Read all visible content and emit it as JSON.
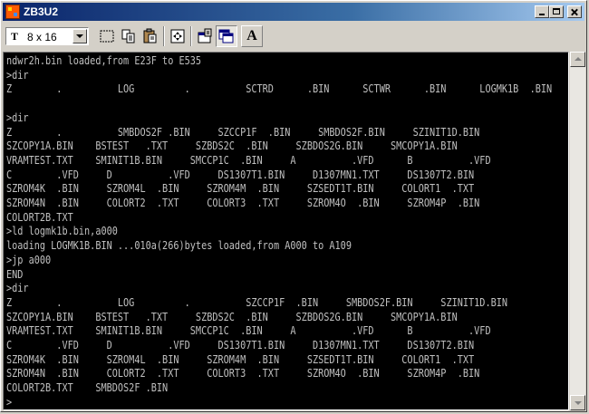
{
  "window": {
    "title": "ZB3U2"
  },
  "toolbar": {
    "font_select_value": "8 x 16",
    "font_icon_glyph": "T",
    "font_button_glyph": "A",
    "icons": [
      "font-select-icon",
      "select-icon",
      "copy-icon",
      "paste-icon",
      "fullscreen-icon",
      "properties-icon",
      "background-icon",
      "font-icon"
    ]
  },
  "console": {
    "text_color": "#c0c0c0",
    "background_color": "#000000",
    "lines": [
      "ndwr2h.bin loaded,from E23F to E535",
      ">dir",
      "Z        .          LOG         .          SCTRD      .BIN      SCTWR      .BIN      LOGMK1B  .BIN",
      "",
      ">dir",
      "Z        .          SMBDOS2F .BIN     SZCCP1F  .BIN     SMBDOS2F.BIN     SZINIT1D.BIN",
      "SZCOPY1A.BIN    BSTEST   .TXT     SZBDS2C  .BIN     SZBDOS2G.BIN     SMCOPY1A.BIN",
      "VRAMTEST.TXT    SMINIT1B.BIN     SMCCP1C  .BIN     A          .VFD      B          .VFD",
      "C        .VFD     D          .VFD     DS1307T1.BIN     D1307MN1.TXT     DS1307T2.BIN",
      "SZROM4K  .BIN     SZROM4L  .BIN     SZROM4M  .BIN     SZSEDT1T.BIN     COLORT1  .TXT",
      "SZROM4N  .BIN     COLORT2  .TXT     COLORT3  .TXT     SZROM4O  .BIN     SZROM4P  .BIN",
      "COLORT2B.TXT",
      ">ld logmk1b.bin,a000",
      "loading LOGMK1B.BIN ...010a(266)bytes loaded,from A000 to A109",
      ">jp a000",
      "END",
      ">dir",
      "Z        .          LOG         .          SZCCP1F  .BIN     SMBDOS2F.BIN     SZINIT1D.BIN",
      "SZCOPY1A.BIN    BSTEST   .TXT     SZBDS2C  .BIN     SZBDOS2G.BIN     SMCOPY1A.BIN",
      "VRAMTEST.TXT    SMINIT1B.BIN     SMCCP1C  .BIN     A          .VFD      B          .VFD",
      "C        .VFD     D          .VFD     DS1307T1.BIN     D1307MN1.TXT     DS1307T2.BIN",
      "SZROM4K  .BIN     SZROM4L  .BIN     SZROM4M  .BIN     SZSEDT1T.BIN     COLORT1  .TXT",
      "SZROM4N  .BIN     COLORT2  .TXT     COLORT3  .TXT     SZROM4O  .BIN     SZROM4P  .BIN",
      "COLORT2B.TXT    SMBDOS2F .BIN",
      ">"
    ]
  }
}
